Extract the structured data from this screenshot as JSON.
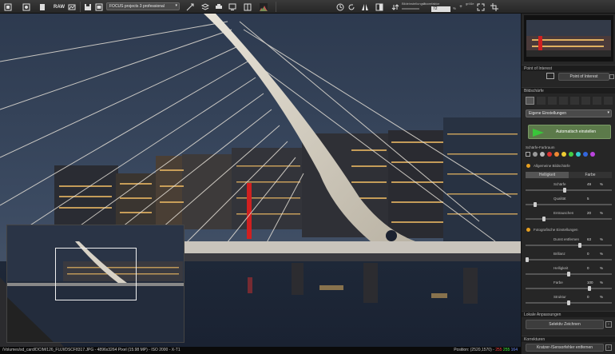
{
  "toolbar": {
    "raw_label": "RAW",
    "preset_select": "FOCUS projects 3 professional",
    "zoom_label": "Zoomfaktor",
    "zoom_value": "72",
    "zoom_unit": "%",
    "size_label": "größe"
  },
  "panel": {
    "poi_header": "Point of Interest",
    "poi_button": "Point of Interest",
    "sharpness_header": "Bildschärfe",
    "preset_select": "Eigene Einstellungen",
    "auto_button": "Automatisch einstellen",
    "color_space_label": "Schärfe-Farbraum",
    "general_sharpness_label": "Allgemeine Bildschärfe",
    "tab_brightness": "Helligkeit",
    "tab_color": "Farbe",
    "sliders_general": [
      {
        "label": "Schärfe",
        "value": "49",
        "unit": "%",
        "level": 0.45
      },
      {
        "label": "Qualität",
        "value": "5",
        "unit": "",
        "level": 0.1
      },
      {
        "label": "Entrauschen",
        "value": "20",
        "unit": "%",
        "level": 0.2
      }
    ],
    "photo_settings_label": "Fotografische Einstellungen",
    "sliders_photo": [
      {
        "label": "Dunst entfernen",
        "value": "63",
        "unit": "%",
        "level": 0.63
      },
      {
        "label": "Brillanz",
        "value": "0",
        "unit": "%",
        "level": 0.0
      },
      {
        "label": "Helligkeit",
        "value": "0",
        "unit": "%",
        "level": 0.5
      },
      {
        "label": "Farbe",
        "value": "100",
        "unit": "%",
        "level": 0.75
      },
      {
        "label": "Struktur",
        "value": "0",
        "unit": "%",
        "level": 0.5
      }
    ],
    "local_header": "Lokale Anpassungen",
    "selective_button": "Selektiv Zeichnen",
    "corrections_header": "Korrekturen",
    "sensor_button": "Kratzer-/Sensorfehler entfernen"
  },
  "status": {
    "file_info": "/Volumes/sd_card/DCIM/126_FUJI/DSCF8317.JPG - 4896x3264 Pixel (15.98 MP)  -  ISO 2000 - X-T1",
    "position": "Position: (2520,1570) -",
    "r": "255",
    "g": "255",
    "b": "164",
    "colors": {
      "r": "#ff4040",
      "g": "#40ff40",
      "b": "#6a8cff"
    }
  }
}
